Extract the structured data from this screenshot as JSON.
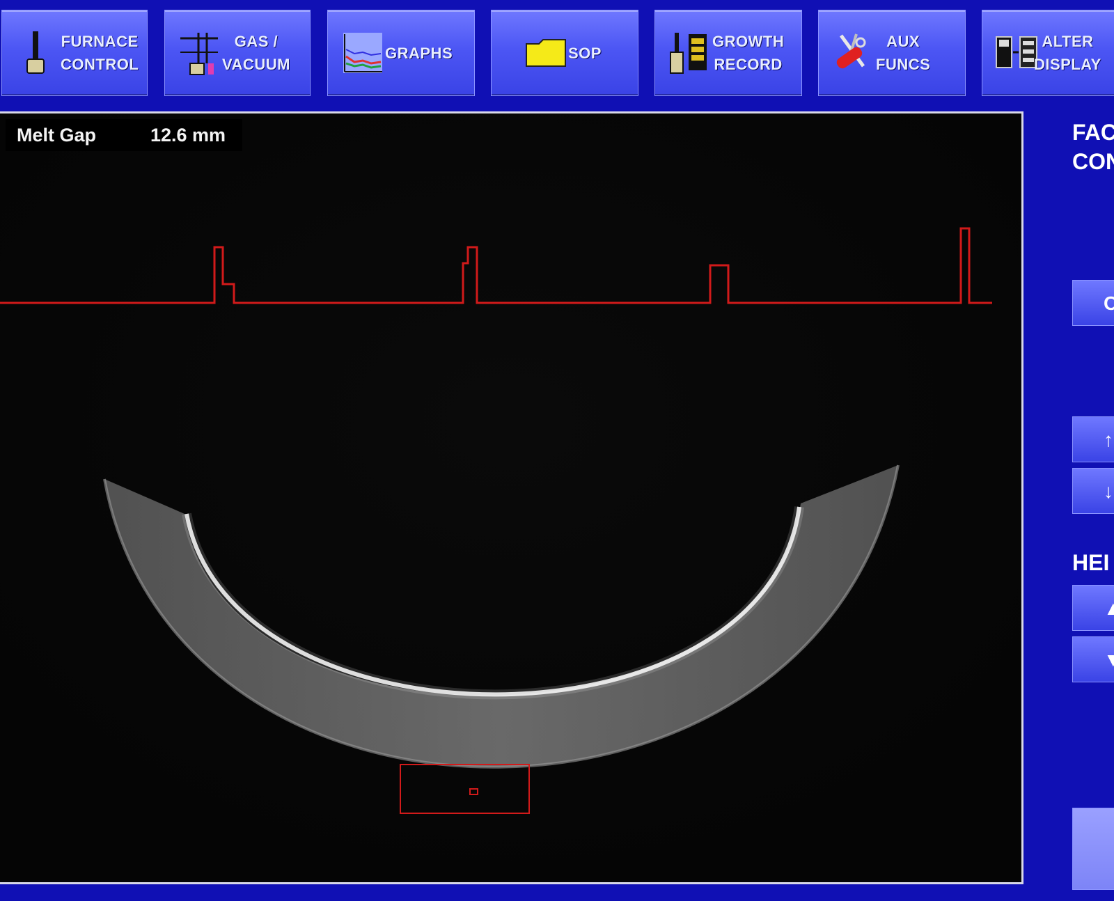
{
  "toolbar": {
    "buttons": [
      {
        "line1": "FURNACE",
        "line2": "CONTROL",
        "icon": "furnace-icon"
      },
      {
        "line1": "GAS /",
        "line2": "VACUUM",
        "icon": "gas-valve-icon"
      },
      {
        "line1": "GRAPHS",
        "line2": "",
        "icon": "graph-icon"
      },
      {
        "line1": "SOP",
        "line2": "",
        "icon": "folder-icon"
      },
      {
        "line1": "GROWTH",
        "line2": "RECORD",
        "icon": "growth-record-icon"
      },
      {
        "line1": "AUX",
        "line2": "FUNCS",
        "icon": "tools-icon"
      },
      {
        "line1": "ALTER",
        "line2": "DISPLAY",
        "icon": "display-icon"
      }
    ]
  },
  "viewport": {
    "readout": {
      "label": "Melt Gap",
      "value": "12.6 mm"
    }
  },
  "side_panel": {
    "title_line1": "FAC",
    "title_line2": "CON",
    "button_c": "C",
    "up_arrow": "↑",
    "down_arrow": "↓",
    "height_label": "HEI",
    "height_up": "▲",
    "height_down": "▼"
  },
  "colors": {
    "background": "#1010b4",
    "button": "#4c56f4",
    "trace": "#d11a1a",
    "viewport": "#050505"
  }
}
